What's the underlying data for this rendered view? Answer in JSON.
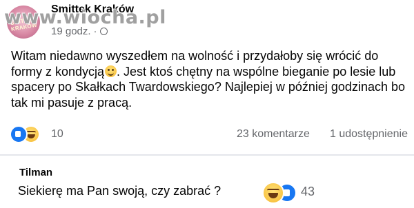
{
  "post": {
    "page_name": "Smittek Kraków",
    "avatar_label": "SMITTEK KRAKÓW",
    "time": "19 godz.",
    "separator": "·",
    "text_part1": "Witam niedawno wyszedłem na wolność i przydałoby się wrócić do formy z kondycją",
    "text_part2": ". Jest ktoś chętny na wspólne bieganie po lesie lub spacery po Skałkach Twardowskiego? Najlepiej w później godzinach bo tak mi pasuje z pracą."
  },
  "watermark": "www.wiocha.pl",
  "reactions": {
    "icons": [
      "like-icon",
      "haha-icon"
    ],
    "count": "10",
    "comments": "23 komentarze",
    "shares": "1 udostępnienie"
  },
  "comment": {
    "author": "Tilman",
    "text": "Siekierę ma Pan swoją, czy zabrać ?",
    "reaction_icons": [
      "haha-icon",
      "like-icon"
    ],
    "reaction_count": "43"
  },
  "colors": {
    "secondary_text": "#65676b",
    "like_blue": "#1877f2",
    "divider": "#e4e6eb"
  }
}
